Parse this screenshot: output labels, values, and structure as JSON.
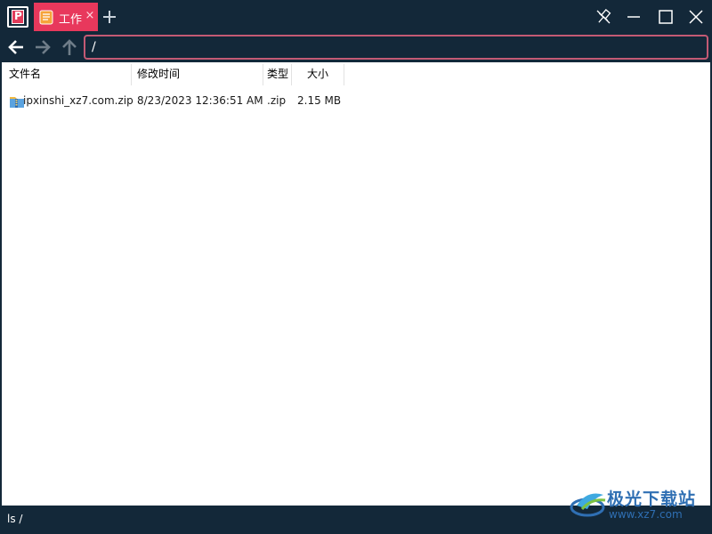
{
  "titlebar": {
    "app_icon": "app-logo-icon",
    "tab": {
      "label": "工作",
      "icon": "notebook-icon",
      "close": "×"
    },
    "new_tab_icon": "plus-icon",
    "window_controls": [
      "pin-icon",
      "minimize-icon",
      "maximize-icon",
      "close-icon"
    ],
    "colors": {
      "bar": "#132839",
      "tab": "#e8385c"
    }
  },
  "nav": {
    "back_icon": "arrow-left-icon",
    "forward_icon": "arrow-right-icon",
    "up_icon": "arrow-up-icon",
    "path": "/"
  },
  "table": {
    "columns": [
      "文件名",
      "修改时间",
      "类型",
      "大小"
    ],
    "rows": [
      {
        "name": "ipxinshi_xz7.com.zip",
        "modified": "8/23/2023 12:36:51 AM",
        "type": ".zip",
        "size": "2.15 MB",
        "icon": "zip-file-icon"
      }
    ]
  },
  "status": {
    "text": "ls /"
  },
  "watermark": {
    "line1": "极光下载站",
    "line2": "www.xz7.com"
  }
}
